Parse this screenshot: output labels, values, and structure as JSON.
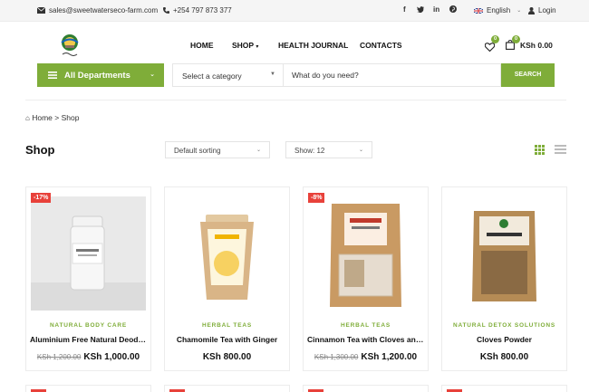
{
  "topbar": {
    "email": "sales@sweetwaterseco-farm.com",
    "phone": "+254 797 873 377",
    "language": "English",
    "login": "Login",
    "social_icons": [
      "facebook-icon",
      "twitter-icon",
      "linkedin-icon",
      "pinterest-icon"
    ]
  },
  "nav": {
    "items": [
      {
        "label": "HOME"
      },
      {
        "label": "SHOP"
      },
      {
        "label": "HEALTH JOURNAL"
      },
      {
        "label": "CONTACTS"
      }
    ],
    "wishlist_count": "0",
    "cart_count": "0",
    "cart_total": "KSh 0.00"
  },
  "search": {
    "departments_label": "All Departments",
    "category_placeholder": "Select a category",
    "input_placeholder": "What do you need?",
    "button_label": "SEARCH"
  },
  "breadcrumb": {
    "home": "Home",
    "separator": ">",
    "current": "Shop"
  },
  "shop": {
    "title": "Shop",
    "sorting": "Default sorting",
    "show": "Show: 12"
  },
  "colors": {
    "accent": "#7fad39",
    "sale": "#e8413a"
  },
  "products": [
    {
      "sale": "-17%",
      "category": "NATURAL BODY CARE",
      "name": "Aluminium Free Natural Deodorant",
      "old_price": "KSh 1,200.00",
      "price": "KSh 1,000.00"
    },
    {
      "sale": "",
      "category": "HERBAL TEAS",
      "name": "Chamomile Tea with Ginger",
      "old_price": "",
      "price": "KSh 800.00"
    },
    {
      "sale": "-8%",
      "category": "HERBAL TEAS",
      "name": "Cinnamon Tea with Cloves and Sa...",
      "old_price": "KSh 1,300.00",
      "price": "KSh 1,200.00"
    },
    {
      "sale": "",
      "category": "NATURAL DETOX SOLUTIONS",
      "name": "Cloves Powder",
      "old_price": "",
      "price": "KSh 800.00"
    }
  ]
}
